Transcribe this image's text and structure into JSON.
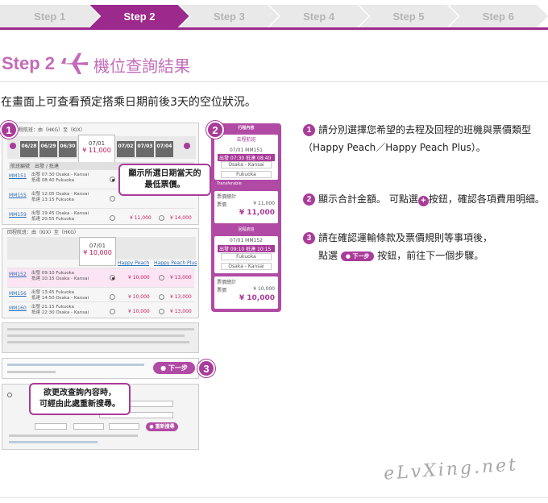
{
  "steps": [
    "Step 1",
    "Step 2",
    "Step 3",
    "Step 4",
    "Step 5",
    "Step 6"
  ],
  "header": {
    "step_label": "Step 2",
    "title": "機位查詢結果"
  },
  "intro": "在畫面上可查看預定搭乘日期前後3天的空位狀況。",
  "outbound": {
    "route": "去程航班：由（HKG）至（KIX）",
    "dates": [
      "06/28",
      "06/29",
      "06/30",
      "07/02",
      "07/03",
      "07/04"
    ],
    "selected_date": "07/01",
    "selected_price": "¥ 11,000",
    "header": [
      "航班編號",
      "出發 / 抵達"
    ],
    "flights": [
      {
        "no": "MM151",
        "times": "出發 07:30 Osaka - Kansai\n抵達 08:40 Fukuoka",
        "price": ""
      },
      {
        "no": "MM155",
        "times": "出發 12:05 Osaka - Kansai\n抵達 13:15 Fukuoka",
        "price": ""
      },
      {
        "no": "MM159",
        "times": "出發 19:45 Osaka - Kansai\n抵達 20:55 Fukuoka",
        "price": "¥ 11,000",
        "price2": "¥ 14,000"
      }
    ]
  },
  "inbound": {
    "route": "回程航班：由（KIX）至（HKG）",
    "selected_date": "07/01",
    "selected_price": "¥ 10,000",
    "plans": [
      "Happy Peach",
      "Happy Peach Plus"
    ],
    "flights": [
      {
        "no": "MM152",
        "times": "出發 09:10 Fukuoka\n抵達 10:15 Osaka - Kansai",
        "price": "¥ 10,000",
        "price2": "¥ 13,000"
      },
      {
        "no": "MM156",
        "times": "出發 13:45 Fukuoka\n抵達 14:50 Osaka - Kansai",
        "price": "¥ 10,000",
        "price2": "¥ 13,000"
      },
      {
        "no": "MM160",
        "times": "出發 21:15 Fukuoka\n抵達 22:30 Osaka - Kansai",
        "price": "¥ 10,000",
        "price2": "¥ 13,000"
      }
    ]
  },
  "sidebar": {
    "title": "行程內容",
    "outbound_label": "去程航班",
    "outbound_flight": "07/01 MM151",
    "outbound_times": "出發 07:30   抵達 08:40",
    "outbound_route1": "Osaka - Kansai",
    "outbound_route2": "Fukuoka",
    "transferable": "Transferable",
    "total_label": "票價總計",
    "fare_label": "票價",
    "fare_value": "¥ 11,000",
    "total_value": "¥ 11,000",
    "inbound_label": "回程航班",
    "inbound_flight": "07/01 MM152",
    "inbound_times": "出發 09:10   抵達 10:15",
    "inbound_route1": "Fukuoka",
    "inbound_route2": "Osaka - Kansai",
    "fare_value2": "¥ 10,000",
    "total_value2": "¥ 10,000"
  },
  "callouts": {
    "lowest": "顯示所選日期當天的\n最低票價。",
    "research": "欲更改查詢內容時，\n可經由此處重新搜尋。"
  },
  "next_button": "● 下一步",
  "research_button": "● 重新搜尋",
  "explanations": {
    "e1": "請分別選擇您希望的去程及回程的班機與票價類型（Happy Peach／Happy Peach Plus）。",
    "e2a": "顯示合計金額。 可點選",
    "e2b": "按鈕，確認各項費用明細。",
    "e3a": "請在確認運輸條款及票價規則等事項後，",
    "e3b": "點選",
    "e3c": "按鈕，前往下一個步驟。",
    "next_icon_label": "下一步"
  },
  "badges": [
    "1",
    "2",
    "3"
  ],
  "watermark": "eLvXing.net"
}
